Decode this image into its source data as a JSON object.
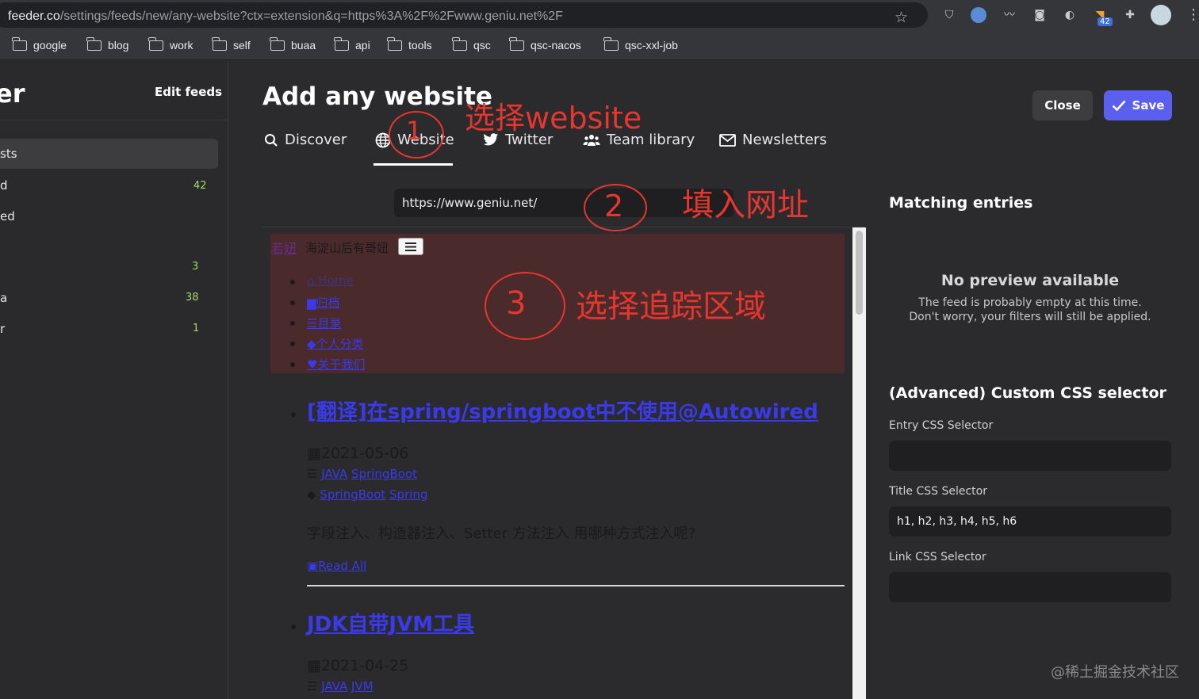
{
  "browser": {
    "url_host": "feeder.co",
    "url_path": "/settings/feeds/new/any-website?ctx=extension&q=https%3A%2F%2Fwww.geniu.net%2F",
    "ext_badge": "42",
    "bookmarks": [
      "google",
      "blog",
      "work",
      "self",
      "buaa",
      "api",
      "tools",
      "qsc",
      "qsc-nacos",
      "qsc-xxl-job"
    ]
  },
  "sidebar": {
    "brand": "er",
    "edit_feeds": "Edit feeds",
    "items": [
      {
        "label": "sts",
        "count": ""
      },
      {
        "label": "d",
        "count": "42"
      },
      {
        "label": "ed",
        "count": ""
      },
      {
        "label": "",
        "count": "3"
      },
      {
        "label": "a",
        "count": "38"
      },
      {
        "label": "r",
        "count": "1"
      }
    ]
  },
  "page": {
    "title": "Add any website",
    "close_label": "Close",
    "save_label": "Save",
    "tabs": [
      {
        "label": "Discover",
        "icon": "search-icon"
      },
      {
        "label": "Website",
        "icon": "globe-icon"
      },
      {
        "label": "Twitter",
        "icon": "twitter-icon"
      },
      {
        "label": "Team library",
        "icon": "team-icon"
      },
      {
        "label": "Newsletters",
        "icon": "envelope-icon"
      }
    ],
    "url_value": "https://www.geniu.net/"
  },
  "preview": {
    "site_logo": "若妞",
    "site_name": "海淀山后有哥妞",
    "nav": [
      "Home",
      "归档",
      "目录",
      "个人分类",
      "关于我们"
    ],
    "posts": [
      {
        "title": "[翻译]在spring/springboot中不使用@Autowired",
        "date": "2021-05-06",
        "categories": [
          "JAVA",
          "SpringBoot"
        ],
        "tags": [
          "SpringBoot",
          "Spring"
        ],
        "excerpt": "字段注入、构造器注入、Setter 方法注入 用哪种方式注入呢?",
        "read_all": "Read All"
      },
      {
        "title": "JDK自带JVM工具",
        "date": "2021-04-25",
        "categories": [
          "JAVA",
          "JVM"
        ]
      }
    ]
  },
  "right_panel": {
    "matching_title": "Matching entries",
    "no_preview_title": "No preview available",
    "no_preview_line1": "The feed is probably empty at this time.",
    "no_preview_line2": "Don't worry, your filters will still be applied.",
    "advanced_title": "(Advanced) Custom CSS selector",
    "entry_label": "Entry CSS Selector",
    "entry_value": "",
    "title_label": "Title CSS Selector",
    "title_value": "h1, h2, h3, h4, h5, h6",
    "link_label": "Link CSS Selector",
    "link_value": ""
  },
  "annotations": {
    "a1_num": "1",
    "a1_text": "选择website",
    "a2_num": "2",
    "a2_text": "填入网址",
    "a3_num": "3",
    "a3_text": "选择追踪区域"
  },
  "watermark": "@稀土掘金技术社区",
  "colors": {
    "accent": "#5a5ff0",
    "annotation": "#e5362f",
    "highlight": "#4a2a2a"
  }
}
